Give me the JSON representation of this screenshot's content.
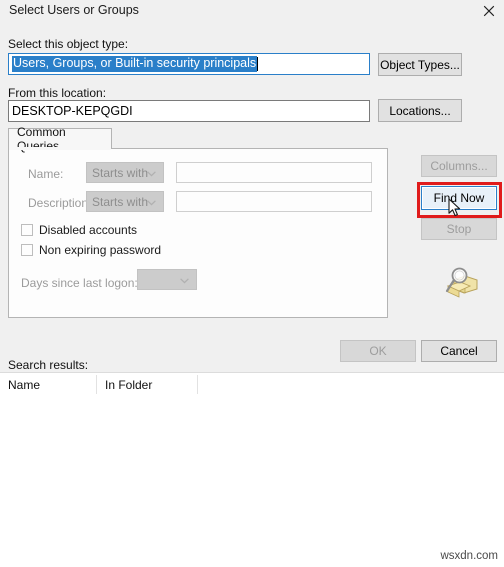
{
  "window": {
    "title": "Select Users or Groups",
    "close_icon": "close-icon"
  },
  "object_type": {
    "label": "Select this object type:",
    "value": "Users, Groups, or Built-in security principals",
    "button": "Object Types..."
  },
  "location": {
    "label": "From this location:",
    "value": "DESKTOP-KEPQGDI",
    "button": "Locations..."
  },
  "tabs": [
    {
      "label": "Common Queries",
      "selected": true
    }
  ],
  "query": {
    "name_label": "Name:",
    "name_operator": "Starts with",
    "name_value": "",
    "description_label": "Description:",
    "description_operator": "Starts with",
    "description_value": "",
    "disabled_accounts_label": "Disabled accounts",
    "disabled_accounts_checked": false,
    "non_expiring_password_label": "Non expiring password",
    "non_expiring_password_checked": false,
    "days_label": "Days since last logon:",
    "days_value": ""
  },
  "side_buttons": {
    "columns": "Columns...",
    "columns_enabled": false,
    "find_now": "Find Now",
    "find_now_focused": true,
    "stop": "Stop",
    "stop_enabled": false,
    "icon": "magnifier-folder-icon"
  },
  "dialog_buttons": {
    "ok": "OK",
    "ok_enabled": false,
    "cancel": "Cancel",
    "cancel_enabled": true
  },
  "results": {
    "label": "Search results:",
    "columns": [
      "Name",
      "In Folder"
    ],
    "rows": []
  },
  "annotation": {
    "highlight_target": "Find Now",
    "highlight_color": "#e01b1b"
  },
  "watermark": "wsxdn.com"
}
